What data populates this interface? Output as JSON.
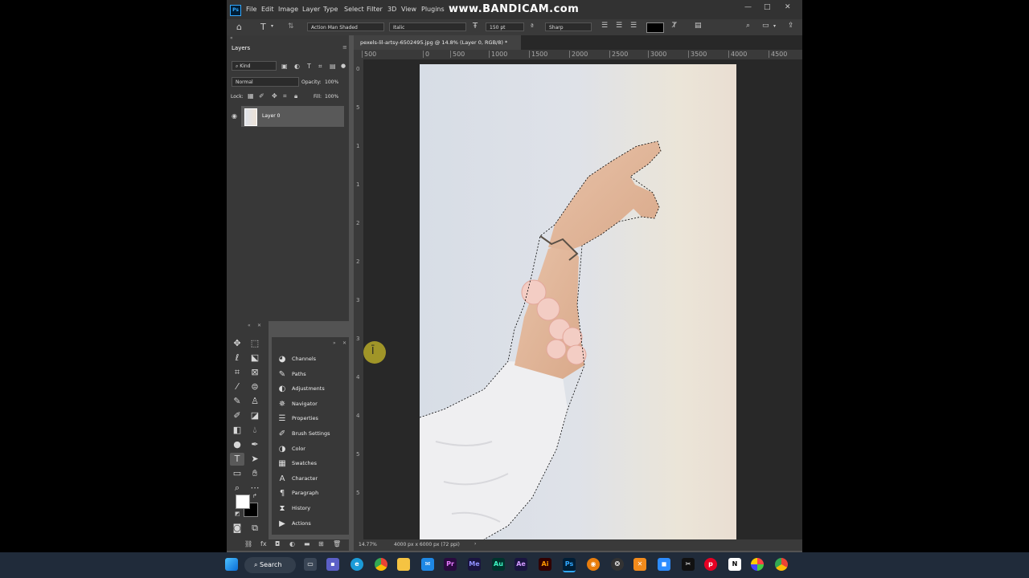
{
  "app": {
    "logo": "Ps",
    "watermark": "www.BANDICAM.com"
  },
  "menu": [
    "File",
    "Edit",
    "Image",
    "Layer",
    "Type",
    "Select",
    "Filter",
    "3D",
    "View",
    "Plugins"
  ],
  "options": {
    "font_family": "Action Man Shaded",
    "font_style": "Italic",
    "font_size": "150 pt",
    "antialias": "Sharp",
    "text_color": "#000000"
  },
  "layers_panel": {
    "title": "Layers",
    "filter_label": "Kind",
    "blend_mode": "Normal",
    "opacity_label": "Opacity:",
    "opacity_value": "100%",
    "lock_label": "Lock:",
    "fill_label": "Fill:",
    "fill_value": "100%",
    "layer_name": "Layer 0"
  },
  "document": {
    "tab_title": "pexels-lil-artsy-6502495.jpg @ 14.8% (Layer 0, RGB/8) *",
    "ruler_h": [
      "500",
      "0",
      "500",
      "1000",
      "1500",
      "2000",
      "2500",
      "3000",
      "3500",
      "4000",
      "4500"
    ],
    "ruler_v": [
      "0",
      "5",
      "1",
      "1",
      "2",
      "2",
      "3",
      "3",
      "4",
      "4",
      "5",
      "5"
    ]
  },
  "panels": [
    {
      "label": "Channels",
      "icon": "channels-icon",
      "glyph": "◕"
    },
    {
      "label": "Paths",
      "icon": "paths-icon",
      "glyph": "✎"
    },
    {
      "label": "Adjustments",
      "icon": "adjustments-icon",
      "glyph": "◐"
    },
    {
      "label": "Navigator",
      "icon": "navigator-icon",
      "glyph": "✵"
    },
    {
      "label": "Properties",
      "icon": "properties-icon",
      "glyph": "☰"
    },
    {
      "label": "Brush Settings",
      "icon": "brush-settings-icon",
      "glyph": "✐"
    },
    {
      "label": "Color",
      "icon": "color-icon",
      "glyph": "◑"
    },
    {
      "label": "Swatches",
      "icon": "swatches-icon",
      "glyph": "▦"
    },
    {
      "label": "Character",
      "icon": "character-icon",
      "glyph": "A"
    },
    {
      "label": "Paragraph",
      "icon": "paragraph-icon",
      "glyph": "¶"
    },
    {
      "label": "History",
      "icon": "history-icon",
      "glyph": "⧗"
    },
    {
      "label": "Actions",
      "icon": "actions-icon",
      "glyph": "▶"
    }
  ],
  "status": {
    "zoom": "14.77%",
    "doc_info": "4000 px x 6000 px (72 ppi)"
  },
  "taskbar": {
    "search_label": "Search"
  },
  "colors": {
    "foreground": "#ffffff",
    "background": "#000000",
    "accent": "#31a8ff"
  }
}
